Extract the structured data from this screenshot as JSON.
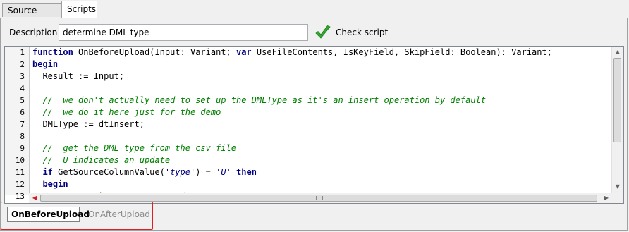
{
  "tabs": [
    {
      "label": "Source values"
    },
    {
      "label": "Scripts"
    }
  ],
  "description": {
    "label": "Description",
    "value": "determine DML type"
  },
  "check_script": {
    "label": "Check script",
    "icon": "green-checkmark-icon",
    "color": "#2ea82e"
  },
  "editor": {
    "line_numbers": [
      "1",
      "2",
      "3",
      "4",
      "5",
      "6",
      "7",
      "8",
      "9",
      "10",
      "11",
      "12",
      "13"
    ],
    "lines": [
      [
        {
          "t": "function",
          "c": "kw"
        },
        {
          "t": " OnBeforeUpload(Input: Variant; "
        },
        {
          "t": "var",
          "c": "kw"
        },
        {
          "t": " UseFileContents, IsKeyField, SkipField: Boolean): Variant;"
        }
      ],
      [
        {
          "t": "begin",
          "c": "kw"
        }
      ],
      [
        {
          "t": "  Result := Input;"
        }
      ],
      [
        {
          "t": ""
        }
      ],
      [
        {
          "t": "  //  we don't actually need to set up the DMLType as it's an insert operation by default",
          "c": "cm"
        }
      ],
      [
        {
          "t": "  //  we do it here just for the demo",
          "c": "cm"
        }
      ],
      [
        {
          "t": "  DMLType := dtInsert;"
        }
      ],
      [
        {
          "t": ""
        }
      ],
      [
        {
          "t": "  //  get the DML type from the csv file",
          "c": "cm"
        }
      ],
      [
        {
          "t": "  //  U indicates an update",
          "c": "cm"
        }
      ],
      [
        {
          "t": "  "
        },
        {
          "t": "if",
          "c": "kw"
        },
        {
          "t": " GetSourceColumnValue("
        },
        {
          "t": "'type'",
          "c": "st"
        },
        {
          "t": ") = "
        },
        {
          "t": "'U'",
          "c": "st"
        },
        {
          "t": " "
        },
        {
          "t": "then",
          "c": "kw"
        }
      ],
      [
        {
          "t": "  "
        },
        {
          "t": "begin",
          "c": "kw"
        }
      ],
      [
        {
          "t": "    //  set the DMLType to update",
          "c": "cm"
        }
      ]
    ]
  },
  "bottom_tabs": [
    {
      "label": "OnBeforeUpload",
      "active": true
    },
    {
      "label": "OnAfterUpload",
      "active": false
    }
  ],
  "colors": {
    "keyword": "#000080",
    "comment": "#008000",
    "highlight_box": "#e02020"
  }
}
